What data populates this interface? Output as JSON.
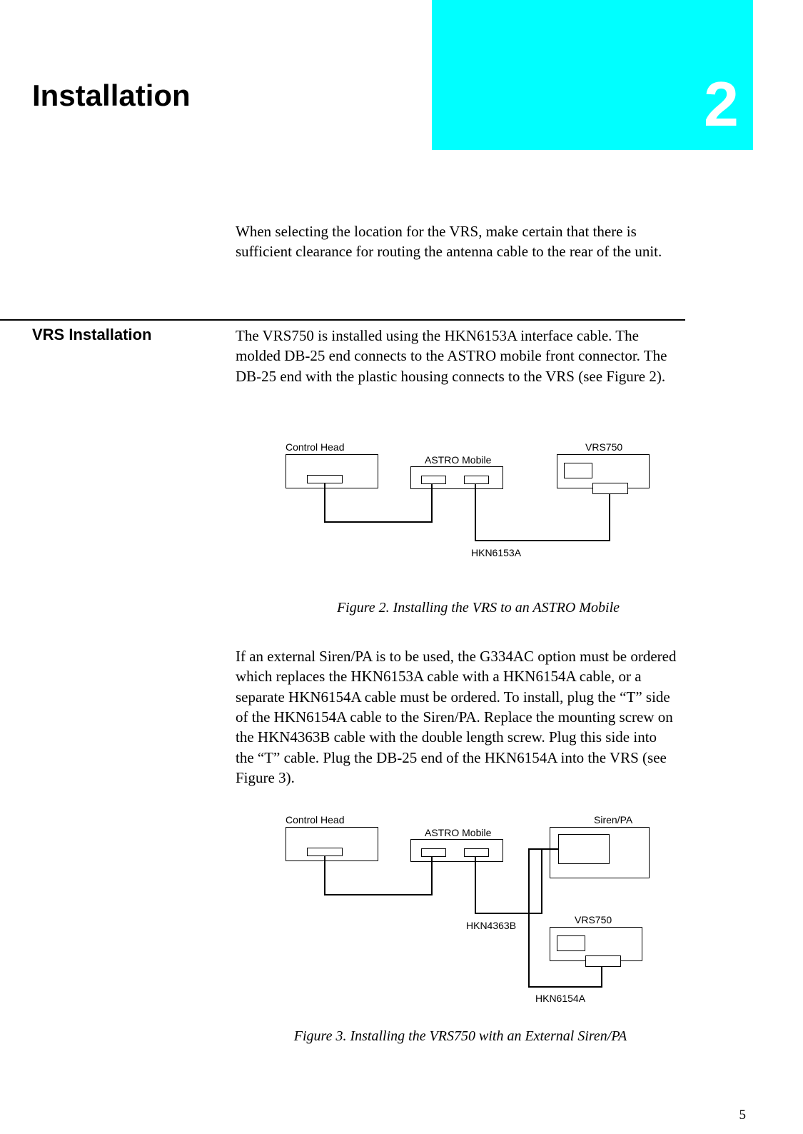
{
  "chapter": {
    "title": "Installation",
    "number": "2"
  },
  "intro": "When selecting the location for the VRS, make certain that there is sufficient clearance for routing the antenna cable to the rear of the unit.",
  "section": {
    "heading": "VRS Installation",
    "para1": "The VRS750 is installed using the HKN6153A interface cable. The molded DB-25 end connects to the ASTRO mobile front connector. The DB-25 end with the plastic housing connects to the VRS (see Figure 2).",
    "para2": "If an external Siren/PA is to be used, the G334AC option must be ordered which replaces the HKN6153A cable with a HKN6154A cable, or a separate HKN6154A cable must be ordered. To install, plug the “T” side of the HKN6154A cable to the Siren/PA. Replace the mounting screw on the HKN4363B cable with the double length screw. Plug this side into the “T” cable. Plug the DB-25 end of the HKN6154A into the VRS (see Figure 3)."
  },
  "figure2": {
    "caption": "Figure 2. Installing the VRS to an ASTRO Mobile",
    "labels": {
      "control_head": "Control Head",
      "astro_mobile": "ASTRO Mobile",
      "vrs750": "VRS750",
      "cable": "HKN6153A"
    }
  },
  "figure3": {
    "caption": "Figure 3. Installing the VRS750 with an External Siren/PA",
    "labels": {
      "control_head": "Control Head",
      "astro_mobile": "ASTRO Mobile",
      "siren_pa": "Siren/PA",
      "vrs750": "VRS750",
      "cable1": "HKN4363B",
      "cable2": "HKN6154A"
    }
  },
  "page_number": "5"
}
